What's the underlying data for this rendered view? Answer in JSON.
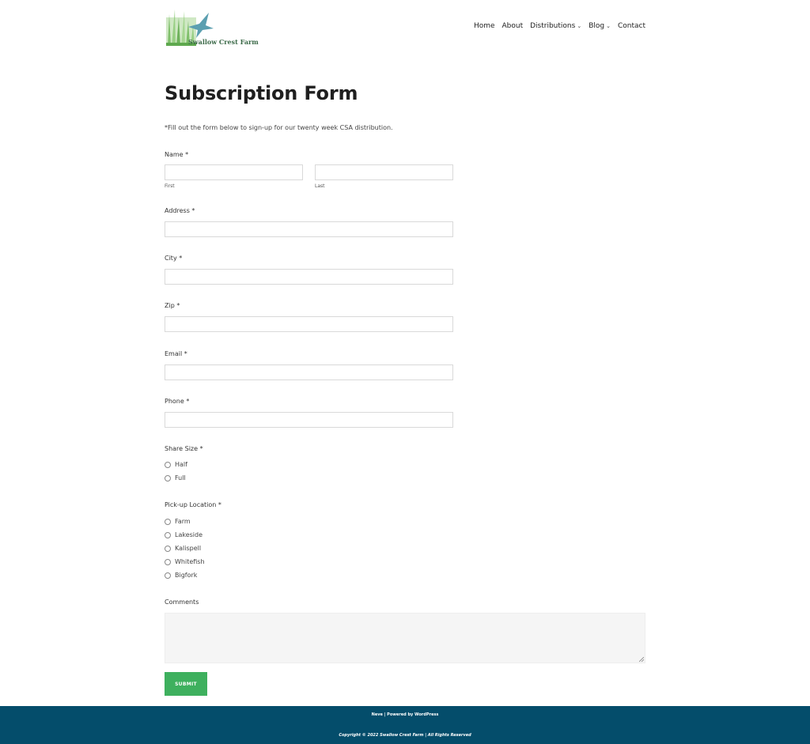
{
  "header": {
    "logo_text": "Swallow Crest Farm",
    "nav": [
      {
        "label": "Home",
        "has_dropdown": false
      },
      {
        "label": "About",
        "has_dropdown": false
      },
      {
        "label": "Distributions",
        "has_dropdown": true
      },
      {
        "label": "Blog",
        "has_dropdown": true
      },
      {
        "label": "Contact",
        "has_dropdown": false
      }
    ]
  },
  "form": {
    "title": "Subscription Form",
    "intro": "*Fill out the form below to sign-up for our twenty week CSA distribution.",
    "name": {
      "label": "Name",
      "required": "*",
      "first_sub": "First",
      "last_sub": "Last",
      "first_value": "",
      "last_value": ""
    },
    "address": {
      "label": "Address",
      "required": "*",
      "value": ""
    },
    "city": {
      "label": "City",
      "required": "*",
      "value": ""
    },
    "zip": {
      "label": "Zip",
      "required": "*",
      "value": ""
    },
    "email": {
      "label": "Email",
      "required": "*",
      "value": ""
    },
    "phone": {
      "label": "Phone",
      "required": "*",
      "value": ""
    },
    "share_size": {
      "label": "Share Size",
      "required": "*",
      "options": [
        "Half",
        "Full"
      ]
    },
    "pickup": {
      "label": "Pick-up Location",
      "required": "*",
      "options": [
        "Farm",
        "Lakeside",
        "Kalispell",
        "Whitefish",
        "Bigfork"
      ]
    },
    "comments": {
      "label": "Comments",
      "value": ""
    },
    "submit_label": "SUBMIT"
  },
  "footer": {
    "line1": "Neve | Powered by WordPress",
    "line2": "Copyright © 2022 Swallow Crest Farm | All Rights Reserved"
  },
  "colors": {
    "submit_bg": "#3eb05e",
    "footer_bg": "#044d6b",
    "logo_bird": "#5b9fb0",
    "logo_grass": "#8cc97a"
  }
}
